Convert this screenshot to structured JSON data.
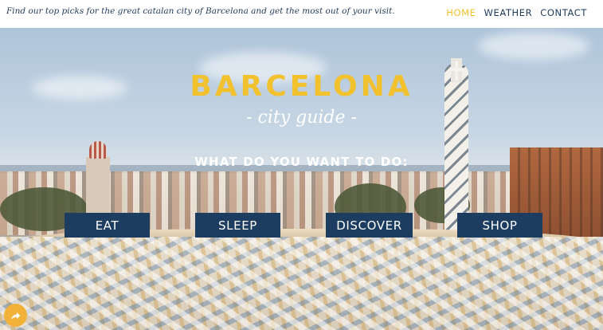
{
  "header": {
    "tagline": "Find our top picks for the great catalan city of Barcelona and get the most out of your visit.",
    "nav": [
      {
        "label": "HOME",
        "active": true
      },
      {
        "label": "WEATHER",
        "active": false
      },
      {
        "label": "CONTACT",
        "active": false
      }
    ]
  },
  "hero": {
    "title": "BARCELONA",
    "subtitle": "- city guide -",
    "question": "WHAT DO YOU WANT TO DO:",
    "buttons": [
      {
        "label": "EAT"
      },
      {
        "label": "SLEEP"
      },
      {
        "label": "DISCOVER"
      },
      {
        "label": "SHOP"
      }
    ]
  },
  "floating": {
    "share_icon": "share-arrow-icon"
  },
  "colors": {
    "accent": "#f2c12e",
    "navy": "#1c3d5f",
    "share": "#f2b23a"
  }
}
